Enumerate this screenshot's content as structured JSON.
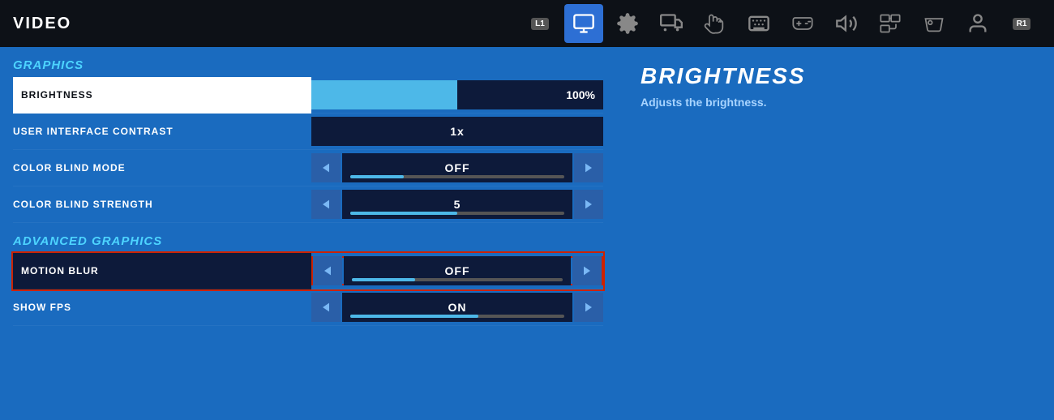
{
  "topBar": {
    "title": "VIDEO",
    "navIcons": [
      {
        "name": "L1-badge",
        "label": "L1"
      },
      {
        "name": "monitor-icon",
        "label": "monitor",
        "active": true
      },
      {
        "name": "gear-icon",
        "label": "gear"
      },
      {
        "name": "display-icon",
        "label": "display"
      },
      {
        "name": "touch-icon",
        "label": "touch"
      },
      {
        "name": "keyboard-icon",
        "label": "keyboard"
      },
      {
        "name": "controller-icon",
        "label": "controller"
      },
      {
        "name": "audio-icon",
        "label": "audio"
      },
      {
        "name": "share-icon",
        "label": "share"
      },
      {
        "name": "gamepad-icon",
        "label": "gamepad"
      },
      {
        "name": "profile-icon",
        "label": "profile"
      },
      {
        "name": "R1-badge",
        "label": "R1"
      }
    ]
  },
  "sections": [
    {
      "title": "GRAPHICS",
      "settings": [
        {
          "label": "BRIGHTNESS",
          "type": "slider",
          "value": "100%",
          "fillPercent": 50,
          "highlighted": true
        },
        {
          "label": "USER INTERFACE CONTRAST",
          "type": "value",
          "value": "1x"
        },
        {
          "label": "COLOR BLIND MODE",
          "type": "arrow",
          "value": "OFF",
          "fillPercent": 25
        },
        {
          "label": "COLOR BLIND STRENGTH",
          "type": "arrow",
          "value": "5",
          "fillPercent": 50
        }
      ]
    },
    {
      "title": "ADVANCED GRAPHICS",
      "settings": [
        {
          "label": "MOTION BLUR",
          "type": "arrow",
          "value": "OFF",
          "fillPercent": 30,
          "redBorder": true
        },
        {
          "label": "SHOW FPS",
          "type": "arrow",
          "value": "ON",
          "fillPercent": 60
        }
      ]
    }
  ],
  "rightPanel": {
    "title": "BRIGHTNESS",
    "description": "Adjusts the brightness."
  },
  "arrows": {
    "left": "◀",
    "right": "▶"
  }
}
